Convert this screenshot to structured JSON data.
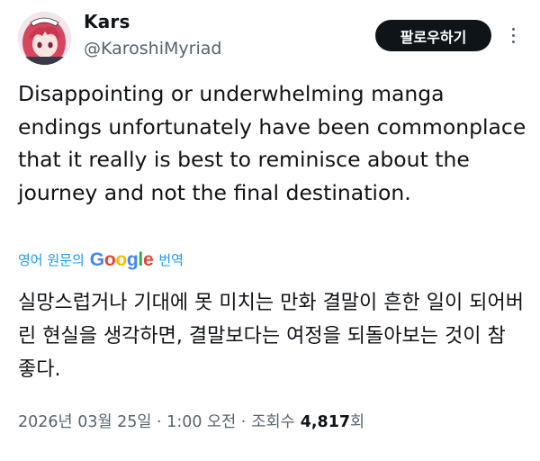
{
  "author": {
    "display_name": "Kars",
    "handle": "@KaroshiMyriad",
    "avatar_icon": "anime-girl-avatar"
  },
  "actions": {
    "follow_label": "팔로우하기",
    "more_icon": "more-vertical-icon"
  },
  "tweet": {
    "text": "Disappointing or underwhelming manga endings unfortunately have been commonplace that it really is best to reminisce about the journey and not the final destination."
  },
  "translation": {
    "prefix": "영어 원문의",
    "brand": "Google",
    "suffix": "번역",
    "text": "실망스럽거나 기대에 못 미치는 만화 결말이 흔한 일이 되어버린 현실을 생각하면, 결말보다는 여정을 되돌아보는 것이 참 좋다."
  },
  "meta": {
    "timestamp": "2026년 03월 25일 · 1:00 오전 · ",
    "views_label": "조회수",
    "views_count": "4,817",
    "views_suffix": "회"
  },
  "colors": {
    "text": "#0f1419",
    "secondary": "#536471",
    "link": "#1d9bf0",
    "button_bg": "#0f1419"
  }
}
